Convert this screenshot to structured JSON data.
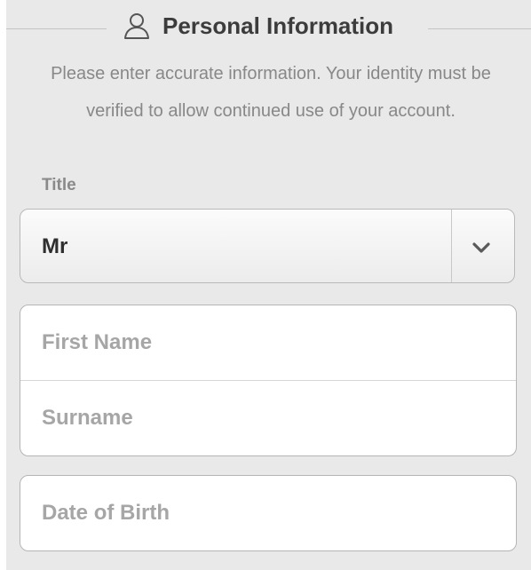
{
  "section": {
    "title": "Personal Information",
    "icon": "person-outline-icon",
    "description": "Please enter accurate information. Your identity must be verified to allow continued use of your account."
  },
  "title_field": {
    "label": "Title",
    "selected": "Mr",
    "icon": "chevron-down-icon"
  },
  "name_fields": {
    "first_name_placeholder": "First Name",
    "first_name_value": "",
    "surname_placeholder": "Surname",
    "surname_value": ""
  },
  "dob_field": {
    "placeholder": "Date of Birth",
    "value": ""
  },
  "colors": {
    "panel_background": "#e9e9e9",
    "heading_text": "#3c3c3c",
    "muted_text": "#888888",
    "placeholder_text": "#a6a6a6",
    "border": "#b9b9b9"
  }
}
